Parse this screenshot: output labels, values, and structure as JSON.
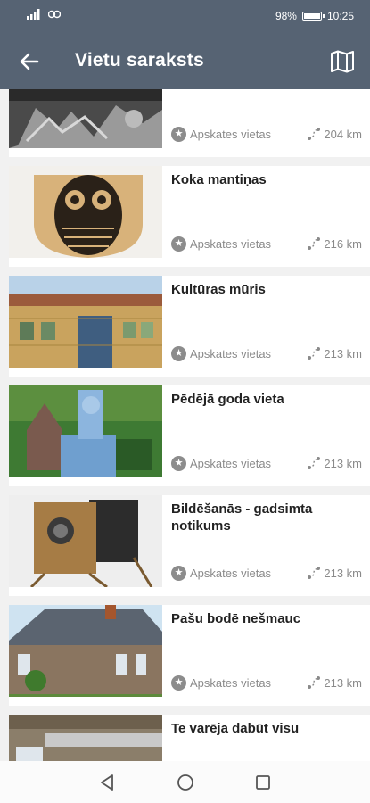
{
  "status": {
    "time": "10:25",
    "battery": "98%"
  },
  "header": {
    "title": "Vietu saraksts"
  },
  "colors": {
    "appbar": "#566373",
    "meta": "#8a8a8a"
  },
  "items": [
    {
      "name": "",
      "category": "Apskates vietas",
      "distance": "204 km"
    },
    {
      "name": "Koka mantiņas",
      "category": "Apskates vietas",
      "distance": "216 km"
    },
    {
      "name": "Kultūras mūris",
      "category": "Apskates vietas",
      "distance": "213 km"
    },
    {
      "name": "Pēdējā goda vieta",
      "category": "Apskates vietas",
      "distance": "213 km"
    },
    {
      "name": "Bildēšanās - gadsimta notikums",
      "category": "Apskates vietas",
      "distance": "213 km"
    },
    {
      "name": "Pašu bodē nešmauc",
      "category": "Apskates vietas",
      "distance": "213 km"
    },
    {
      "name": "Te varēja dabūt visu",
      "category": "",
      "distance": ""
    }
  ]
}
